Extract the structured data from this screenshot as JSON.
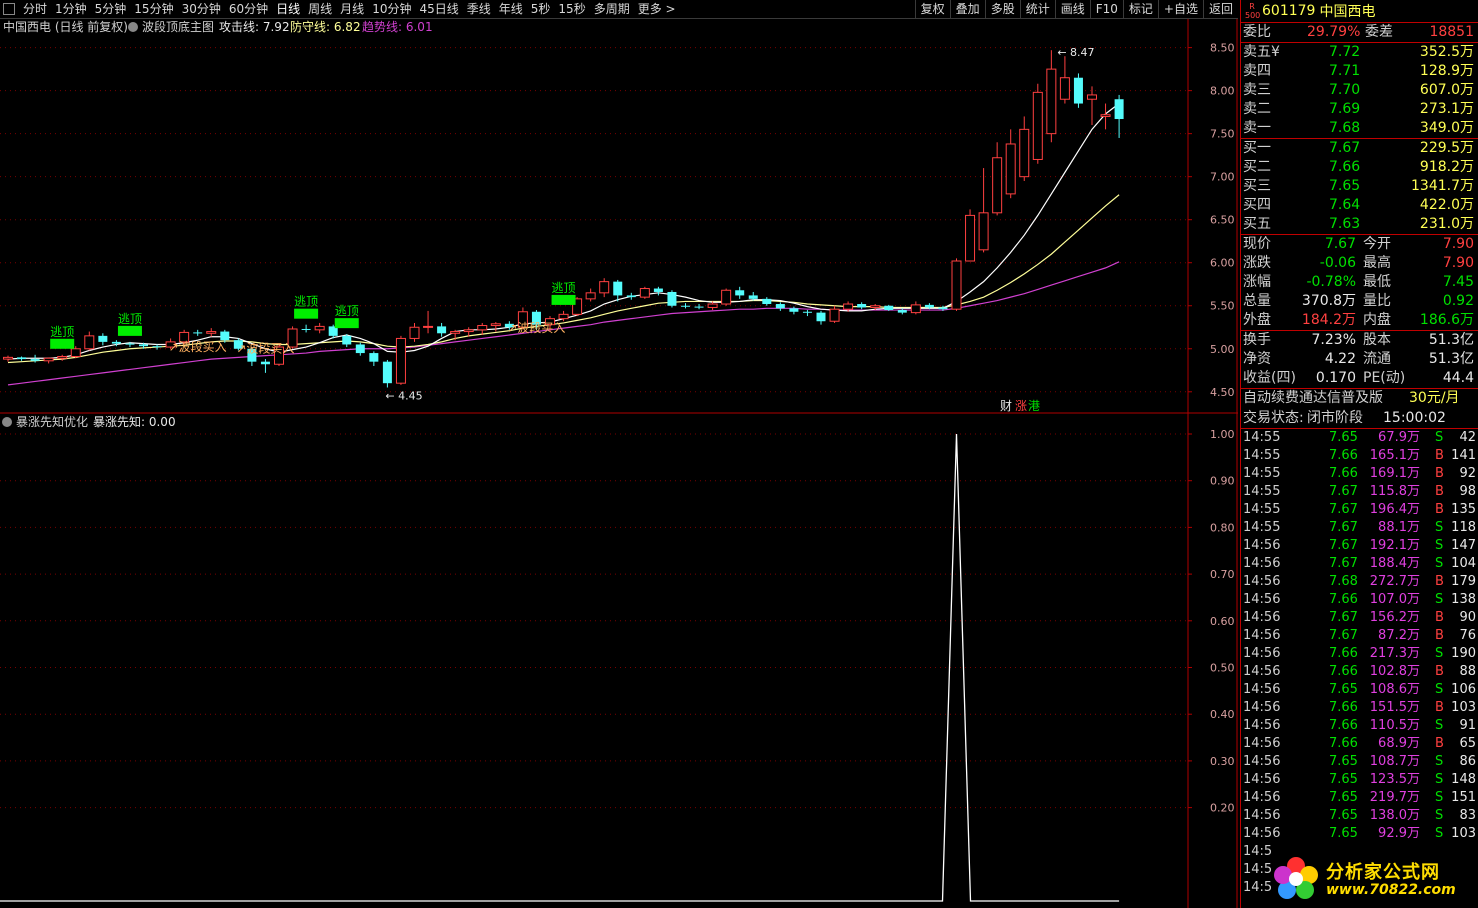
{
  "toolbar": {
    "periods": [
      "分时",
      "1分钟",
      "5分钟",
      "15分钟",
      "30分钟",
      "60分钟",
      "日线",
      "周线",
      "月线",
      "10分钟",
      "45日线",
      "季线",
      "年线",
      "5秒",
      "15秒",
      "多周期",
      "更多 >"
    ],
    "right_buttons": [
      "复权",
      "叠加",
      "多股",
      "统计",
      "画线",
      "F10",
      "标记",
      "+自选",
      "返回"
    ]
  },
  "main_panel": {
    "title_name": "中国西电 (日线 前复权)",
    "indicator_name": "波段顶底主图",
    "attack_label": "攻击线: 7.92",
    "defense_label": "防守线: 6.82",
    "trend_label": "趋势线: 6.01",
    "y_ticks": [
      "8.50",
      "8.00",
      "7.50",
      "7.00",
      "6.50",
      "6.00",
      "5.50",
      "5.00",
      "4.50"
    ],
    "high_label": "8.47",
    "low_label": "4.45",
    "signals": [
      {
        "text": "逃顶",
        "index": 4
      },
      {
        "text": "逃顶",
        "index": 9
      },
      {
        "text": "逃顶",
        "index": 22
      },
      {
        "text": "逃顶",
        "index": 25
      },
      {
        "text": "逃顶",
        "index": 41
      }
    ],
    "buy_signals": [
      {
        "text": "波段买入",
        "index": 12
      },
      {
        "text": "波段买入",
        "index": 17
      },
      {
        "text": "波段买入",
        "index": 37
      }
    ],
    "badge": {
      "cai": "财",
      "zhang": "涨",
      "gang": "港"
    }
  },
  "sub_panel": {
    "title": "暴涨先知优化",
    "value_label": "暴涨先知: 0.00",
    "y_ticks": [
      "1.00",
      "0.90",
      "0.80",
      "0.70",
      "0.60",
      "0.50",
      "0.40",
      "0.30",
      "0.20"
    ]
  },
  "chart_data": {
    "type": "candlestick",
    "y_range": [
      4.3,
      8.6
    ],
    "candles": [
      [
        4.88,
        4.92,
        4.85,
        4.9
      ],
      [
        4.9,
        4.91,
        4.86,
        4.88
      ],
      [
        4.88,
        4.93,
        4.84,
        4.86
      ],
      [
        4.86,
        4.9,
        4.83,
        4.89
      ],
      [
        4.89,
        4.93,
        4.86,
        4.91
      ],
      [
        4.91,
        5.03,
        4.89,
        5.0
      ],
      [
        5.0,
        5.2,
        4.98,
        5.15
      ],
      [
        5.15,
        5.18,
        5.04,
        5.08
      ],
      [
        5.08,
        5.1,
        5.03,
        5.06
      ],
      [
        5.06,
        5.08,
        5.02,
        5.05
      ],
      [
        5.05,
        5.07,
        5.0,
        5.03
      ],
      [
        5.03,
        5.05,
        4.99,
        5.02
      ],
      [
        5.02,
        5.12,
        5.0,
        5.08
      ],
      [
        5.08,
        5.22,
        5.05,
        5.19
      ],
      [
        5.19,
        5.22,
        5.15,
        5.18
      ],
      [
        5.18,
        5.24,
        5.14,
        5.2
      ],
      [
        5.2,
        5.22,
        5.07,
        5.1
      ],
      [
        5.1,
        5.12,
        4.98,
        5.0
      ],
      [
        5.0,
        5.02,
        4.8,
        4.85
      ],
      [
        4.85,
        4.88,
        4.72,
        4.82
      ],
      [
        4.82,
        5.05,
        4.8,
        5.02
      ],
      [
        5.02,
        5.26,
        5.0,
        5.23
      ],
      [
        5.23,
        5.28,
        5.19,
        5.22
      ],
      [
        5.22,
        5.3,
        5.18,
        5.26
      ],
      [
        5.26,
        5.28,
        5.12,
        5.15
      ],
      [
        5.15,
        5.17,
        5.02,
        5.05
      ],
      [
        5.05,
        5.07,
        4.92,
        4.95
      ],
      [
        4.95,
        4.97,
        4.8,
        4.85
      ],
      [
        4.85,
        4.87,
        4.55,
        4.6
      ],
      [
        4.6,
        5.15,
        4.58,
        5.12
      ],
      [
        5.12,
        5.3,
        5.08,
        5.25
      ],
      [
        5.25,
        5.44,
        5.18,
        5.26
      ],
      [
        5.26,
        5.3,
        5.14,
        5.18
      ],
      [
        5.18,
        5.22,
        5.1,
        5.2
      ],
      [
        5.2,
        5.25,
        5.14,
        5.22
      ],
      [
        5.22,
        5.3,
        5.16,
        5.27
      ],
      [
        5.27,
        5.31,
        5.2,
        5.29
      ],
      [
        5.29,
        5.32,
        5.22,
        5.25
      ],
      [
        5.25,
        5.48,
        5.23,
        5.43
      ],
      [
        5.43,
        5.45,
        5.22,
        5.28
      ],
      [
        5.28,
        5.38,
        5.2,
        5.35
      ],
      [
        5.35,
        5.44,
        5.32,
        5.4
      ],
      [
        5.4,
        5.6,
        5.38,
        5.58
      ],
      [
        5.58,
        5.7,
        5.55,
        5.65
      ],
      [
        5.65,
        5.82,
        5.6,
        5.78
      ],
      [
        5.78,
        5.8,
        5.55,
        5.62
      ],
      [
        5.62,
        5.65,
        5.57,
        5.6
      ],
      [
        5.6,
        5.72,
        5.58,
        5.7
      ],
      [
        5.7,
        5.72,
        5.62,
        5.66
      ],
      [
        5.66,
        5.68,
        5.48,
        5.5
      ],
      [
        5.5,
        5.53,
        5.47,
        5.49
      ],
      [
        5.49,
        5.52,
        5.46,
        5.48
      ],
      [
        5.48,
        5.55,
        5.45,
        5.52
      ],
      [
        5.52,
        5.7,
        5.5,
        5.68
      ],
      [
        5.68,
        5.72,
        5.58,
        5.62
      ],
      [
        5.62,
        5.66,
        5.56,
        5.58
      ],
      [
        5.58,
        5.6,
        5.5,
        5.52
      ],
      [
        5.52,
        5.54,
        5.44,
        5.47
      ],
      [
        5.47,
        5.49,
        5.4,
        5.43
      ],
      [
        5.43,
        5.45,
        5.38,
        5.42
      ],
      [
        5.42,
        5.44,
        5.28,
        5.32
      ],
      [
        5.32,
        5.5,
        5.3,
        5.46
      ],
      [
        5.46,
        5.55,
        5.43,
        5.52
      ],
      [
        5.52,
        5.54,
        5.46,
        5.48
      ],
      [
        5.48,
        5.52,
        5.45,
        5.5
      ],
      [
        5.5,
        5.51,
        5.44,
        5.45
      ],
      [
        5.45,
        5.47,
        5.4,
        5.42
      ],
      [
        5.42,
        5.55,
        5.4,
        5.51
      ],
      [
        5.51,
        5.53,
        5.46,
        5.48
      ],
      [
        5.48,
        5.5,
        5.44,
        5.46
      ],
      [
        5.46,
        6.05,
        5.44,
        6.02
      ],
      [
        6.02,
        6.62,
        6.12,
        6.55
      ],
      [
        6.15,
        7.1,
        6.12,
        6.58
      ],
      [
        6.58,
        7.4,
        6.55,
        7.22
      ],
      [
        6.8,
        7.55,
        6.75,
        7.38
      ],
      [
        7.0,
        7.7,
        6.95,
        7.55
      ],
      [
        7.2,
        8.08,
        7.15,
        7.98
      ],
      [
        7.5,
        8.47,
        7.4,
        8.25
      ],
      [
        7.9,
        8.4,
        7.85,
        8.15
      ],
      [
        8.15,
        8.2,
        7.8,
        7.85
      ],
      [
        7.9,
        8.05,
        7.6,
        7.95
      ],
      [
        7.7,
        7.85,
        7.55,
        7.72
      ],
      [
        7.9,
        7.95,
        7.45,
        7.67
      ]
    ],
    "ma_white": [
      4.88,
      4.89,
      4.89,
      4.89,
      4.9,
      4.93,
      4.98,
      5.02,
      5.05,
      5.07,
      5.06,
      5.05,
      5.05,
      5.07,
      5.1,
      5.14,
      5.14,
      5.12,
      5.06,
      5.0,
      4.96,
      4.99,
      5.02,
      5.07,
      5.13,
      5.16,
      5.12,
      5.06,
      4.97,
      4.96,
      4.98,
      5.03,
      5.12,
      5.2,
      5.22,
      5.22,
      5.23,
      5.25,
      5.29,
      5.3,
      5.31,
      5.35,
      5.39,
      5.44,
      5.52,
      5.57,
      5.61,
      5.63,
      5.65,
      5.63,
      5.6,
      5.56,
      5.54,
      5.54,
      5.55,
      5.57,
      5.57,
      5.56,
      5.53,
      5.49,
      5.46,
      5.45,
      5.44,
      5.44,
      5.46,
      5.47,
      5.47,
      5.47,
      5.47,
      5.47,
      5.55,
      5.66,
      5.78,
      5.94,
      6.12,
      6.32,
      6.55,
      6.8,
      7.05,
      7.3,
      7.55,
      7.73,
      7.85
    ],
    "ma_yellow": [
      4.84,
      4.85,
      4.86,
      4.87,
      4.88,
      4.9,
      4.93,
      4.96,
      4.98,
      5.0,
      5.01,
      5.02,
      5.03,
      5.04,
      5.06,
      5.08,
      5.09,
      5.09,
      5.08,
      5.06,
      5.05,
      5.05,
      5.06,
      5.07,
      5.08,
      5.09,
      5.08,
      5.06,
      5.03,
      5.02,
      5.03,
      5.05,
      5.08,
      5.12,
      5.15,
      5.17,
      5.19,
      5.21,
      5.24,
      5.26,
      5.28,
      5.3,
      5.33,
      5.36,
      5.4,
      5.44,
      5.47,
      5.5,
      5.53,
      5.54,
      5.55,
      5.55,
      5.55,
      5.55,
      5.55,
      5.56,
      5.56,
      5.55,
      5.54,
      5.52,
      5.51,
      5.5,
      5.49,
      5.49,
      5.49,
      5.48,
      5.48,
      5.48,
      5.48,
      5.48,
      5.51,
      5.55,
      5.6,
      5.68,
      5.77,
      5.87,
      5.98,
      6.1,
      6.24,
      6.38,
      6.52,
      6.66,
      6.79
    ],
    "ma_purple": [
      4.58,
      4.6,
      4.62,
      4.64,
      4.66,
      4.68,
      4.7,
      4.72,
      4.74,
      4.76,
      4.78,
      4.8,
      4.82,
      4.84,
      4.86,
      4.88,
      4.89,
      4.9,
      4.91,
      4.92,
      4.93,
      4.94,
      4.95,
      4.97,
      4.98,
      4.99,
      5.0,
      5.0,
      5.0,
      5.01,
      5.02,
      5.04,
      5.06,
      5.08,
      5.1,
      5.12,
      5.14,
      5.16,
      5.18,
      5.2,
      5.22,
      5.24,
      5.26,
      5.28,
      5.31,
      5.33,
      5.35,
      5.37,
      5.39,
      5.41,
      5.42,
      5.43,
      5.44,
      5.45,
      5.46,
      5.46,
      5.47,
      5.47,
      5.47,
      5.46,
      5.46,
      5.45,
      5.45,
      5.45,
      5.45,
      5.45,
      5.45,
      5.45,
      5.45,
      5.45,
      5.47,
      5.5,
      5.53,
      5.56,
      5.6,
      5.64,
      5.69,
      5.74,
      5.79,
      5.84,
      5.89,
      5.94,
      6.01
    ],
    "sub_series": {
      "spike_index": 70,
      "spike_value": 1.0,
      "base": 0.0
    }
  },
  "quote": {
    "code": "601179",
    "name": "中国西电",
    "weibi_label": "委比",
    "weibi_value": "29.79%",
    "weicha_label": "委差",
    "weicha_value": "18851",
    "asks": [
      {
        "label": "卖五",
        "flag": "¥",
        "price": "7.72",
        "vol": "352.5万"
      },
      {
        "label": "卖四",
        "flag": "",
        "price": "7.71",
        "vol": "128.9万"
      },
      {
        "label": "卖三",
        "flag": "",
        "price": "7.70",
        "vol": "607.0万"
      },
      {
        "label": "卖二",
        "flag": "",
        "price": "7.69",
        "vol": "273.1万"
      },
      {
        "label": "卖一",
        "flag": "",
        "price": "7.68",
        "vol": "349.0万"
      }
    ],
    "bids": [
      {
        "label": "买一",
        "price": "7.67",
        "vol": "229.5万"
      },
      {
        "label": "买二",
        "price": "7.66",
        "vol": "918.2万"
      },
      {
        "label": "买三",
        "price": "7.65",
        "vol": "1341.7万"
      },
      {
        "label": "买四",
        "price": "7.64",
        "vol": "422.0万"
      },
      {
        "label": "买五",
        "price": "7.63",
        "vol": "231.0万"
      }
    ],
    "stats": [
      {
        "l1": "现价",
        "v1": "7.67",
        "c1": "green",
        "l2": "今开",
        "v2": "7.90",
        "c2": "red"
      },
      {
        "l1": "涨跌",
        "v1": "-0.06",
        "c1": "green",
        "l2": "最高",
        "v2": "7.90",
        "c2": "red"
      },
      {
        "l1": "涨幅",
        "v1": "-0.78%",
        "c1": "green",
        "l2": "最低",
        "v2": "7.45",
        "c2": "green"
      },
      {
        "l1": "总量",
        "v1": "370.8万",
        "c1": "white",
        "l2": "量比",
        "v2": "0.92",
        "c2": "green"
      },
      {
        "l1": "外盘",
        "v1": "184.2万",
        "c1": "red",
        "l2": "内盘",
        "v2": "186.6万",
        "c2": "green"
      }
    ],
    "stats2": [
      {
        "l1": "换手",
        "v1": "7.23%",
        "l2": "股本",
        "v2": "51.3亿"
      },
      {
        "l1": "净资",
        "v1": "4.22",
        "l2": "流通",
        "v2": "51.3亿"
      },
      {
        "l1": "收益(四)",
        "v1": "0.170",
        "l2": "PE(动)",
        "v2": "44.4"
      }
    ],
    "ad_text": "自动续费通达信普及版",
    "ad_price": "30元/月",
    "status_label": "交易状态:",
    "status_value": "闭市阶段",
    "status_time": "15:00:02",
    "ticks": [
      {
        "t": "14:55",
        "p": "7.65",
        "pc": "green",
        "v": "67.9万",
        "bs": "S",
        "n": "42"
      },
      {
        "t": "14:55",
        "p": "7.66",
        "pc": "green",
        "v": "165.1万",
        "bs": "B",
        "n": "141"
      },
      {
        "t": "14:55",
        "p": "7.66",
        "pc": "green",
        "v": "169.1万",
        "bs": "B",
        "n": "92"
      },
      {
        "t": "14:55",
        "p": "7.67",
        "pc": "green",
        "v": "115.8万",
        "bs": "B",
        "n": "98"
      },
      {
        "t": "14:55",
        "p": "7.67",
        "pc": "green",
        "v": "196.4万",
        "bs": "B",
        "n": "135"
      },
      {
        "t": "14:55",
        "p": "7.67",
        "pc": "green",
        "v": "88.1万",
        "bs": "S",
        "n": "118"
      },
      {
        "t": "14:56",
        "p": "7.67",
        "pc": "green",
        "v": "192.1万",
        "bs": "S",
        "n": "147"
      },
      {
        "t": "14:56",
        "p": "7.67",
        "pc": "green",
        "v": "188.4万",
        "bs": "S",
        "n": "104"
      },
      {
        "t": "14:56",
        "p": "7.68",
        "pc": "green",
        "v": "272.7万",
        "bs": "B",
        "n": "179"
      },
      {
        "t": "14:56",
        "p": "7.66",
        "pc": "green",
        "v": "107.0万",
        "bs": "S",
        "n": "138"
      },
      {
        "t": "14:56",
        "p": "7.67",
        "pc": "green",
        "v": "156.2万",
        "bs": "B",
        "n": "90"
      },
      {
        "t": "14:56",
        "p": "7.67",
        "pc": "green",
        "v": "87.2万",
        "bs": "B",
        "n": "76"
      },
      {
        "t": "14:56",
        "p": "7.66",
        "pc": "green",
        "v": "217.3万",
        "bs": "S",
        "n": "190"
      },
      {
        "t": "14:56",
        "p": "7.66",
        "pc": "green",
        "v": "102.8万",
        "bs": "B",
        "n": "88"
      },
      {
        "t": "14:56",
        "p": "7.65",
        "pc": "green",
        "v": "108.6万",
        "bs": "S",
        "n": "106"
      },
      {
        "t": "14:56",
        "p": "7.66",
        "pc": "green",
        "v": "151.5万",
        "bs": "B",
        "n": "103"
      },
      {
        "t": "14:56",
        "p": "7.66",
        "pc": "green",
        "v": "110.5万",
        "bs": "S",
        "n": "91"
      },
      {
        "t": "14:56",
        "p": "7.66",
        "pc": "green",
        "v": "68.9万",
        "bs": "B",
        "n": "65"
      },
      {
        "t": "14:56",
        "p": "7.65",
        "pc": "green",
        "v": "108.7万",
        "bs": "S",
        "n": "86"
      },
      {
        "t": "14:56",
        "p": "7.65",
        "pc": "green",
        "v": "123.5万",
        "bs": "S",
        "n": "148"
      },
      {
        "t": "14:56",
        "p": "7.65",
        "pc": "green",
        "v": "219.7万",
        "bs": "S",
        "n": "151"
      },
      {
        "t": "14:56",
        "p": "7.65",
        "pc": "green",
        "v": "138.0万",
        "bs": "S",
        "n": "83"
      },
      {
        "t": "14:56",
        "p": "7.65",
        "pc": "green",
        "v": "92.9万",
        "bs": "S",
        "n": "103"
      },
      {
        "t": "14:5",
        "p": "",
        "pc": "green",
        "v": "",
        "bs": "",
        "n": ""
      },
      {
        "t": "14:5",
        "p": "",
        "pc": "green",
        "v": "",
        "bs": "",
        "n": ""
      },
      {
        "t": "14:5",
        "p": "",
        "pc": "green",
        "v": "",
        "bs": "",
        "n": ""
      }
    ]
  },
  "watermark": {
    "name": "分析家公式网",
    "url": "www.70822.com"
  },
  "colors": {
    "up": "#ff4040",
    "down": "#54fcfc",
    "signal_green": "#00ee00",
    "ma_white": "#ffffff",
    "ma_yellow": "#ffff99",
    "ma_purple": "#d040d0",
    "grid": "#7a0000",
    "axis": "#b00000"
  }
}
